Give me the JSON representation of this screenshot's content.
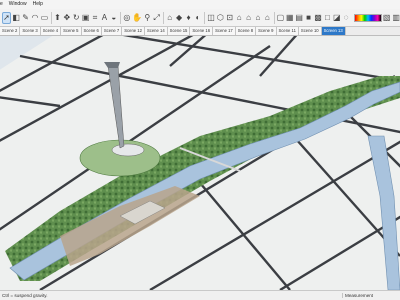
{
  "menubar": {
    "items": [
      {
        "label": "e"
      },
      {
        "label": "Window"
      },
      {
        "label": "Help"
      }
    ]
  },
  "toolbar": {
    "tools": [
      {
        "icon": "select-arrow-icon",
        "glyph": "➚",
        "selected": true
      },
      {
        "icon": "eraser-icon",
        "glyph": "◧"
      },
      {
        "icon": "line-pencil-icon",
        "glyph": "✎"
      },
      {
        "icon": "arc-icon",
        "glyph": "◠"
      },
      {
        "icon": "rectangle-icon",
        "glyph": "▭"
      },
      {
        "icon": "push-pull-icon",
        "glyph": "⬆"
      },
      {
        "icon": "move-icon",
        "glyph": "✥"
      },
      {
        "icon": "rotate-icon",
        "glyph": "↻"
      },
      {
        "icon": "offset-icon",
        "glyph": "▣"
      },
      {
        "icon": "tape-measure-icon",
        "glyph": "⌗"
      },
      {
        "icon": "text-icon",
        "glyph": "A"
      },
      {
        "icon": "paint-bucket-icon",
        "glyph": "◒"
      },
      {
        "icon": "orbit-icon",
        "glyph": "◎"
      },
      {
        "icon": "pan-icon",
        "glyph": "✋"
      },
      {
        "icon": "zoom-icon",
        "glyph": "⚲"
      },
      {
        "icon": "zoom-extents-icon",
        "glyph": "⤢"
      },
      {
        "icon": "warehouse-icon",
        "glyph": "⌂"
      },
      {
        "icon": "extension-icon",
        "glyph": "◆"
      },
      {
        "icon": "ruby-gem-icon",
        "glyph": "♦"
      },
      {
        "icon": "style-icon",
        "glyph": "◐"
      },
      {
        "icon": "section-plane-icon",
        "glyph": "◫"
      },
      {
        "icon": "iso-view-icon",
        "glyph": "⬡"
      },
      {
        "icon": "top-view-icon",
        "glyph": "⊡"
      },
      {
        "icon": "front-view-icon",
        "glyph": "⌂"
      },
      {
        "icon": "right-view-icon",
        "glyph": "⌂"
      },
      {
        "icon": "back-view-icon",
        "glyph": "⌂"
      },
      {
        "icon": "left-view-icon",
        "glyph": "⌂"
      },
      {
        "icon": "xray-icon",
        "glyph": "▢"
      },
      {
        "icon": "wireframe-icon",
        "glyph": "▦"
      },
      {
        "icon": "hidden-line-icon",
        "glyph": "▤"
      },
      {
        "icon": "shaded-icon",
        "glyph": "■"
      },
      {
        "icon": "textured-icon",
        "glyph": "▩"
      },
      {
        "icon": "monochrome-icon",
        "glyph": "□"
      },
      {
        "icon": "shadows-icon",
        "glyph": "◪"
      },
      {
        "icon": "fog-icon",
        "glyph": "◌"
      }
    ],
    "color_ramp_icon": "color-ramp-icon",
    "trailing_tools": [
      {
        "icon": "edge-style-icon",
        "glyph": "▧"
      },
      {
        "icon": "profiles-icon",
        "glyph": "▥"
      }
    ]
  },
  "scene_tabs": [
    {
      "label": "Scene 2"
    },
    {
      "label": "Scene 3"
    },
    {
      "label": "Scene 4"
    },
    {
      "label": "Scene 5"
    },
    {
      "label": "Scene 6"
    },
    {
      "label": "Scene 7"
    },
    {
      "label": "Scene 12"
    },
    {
      "label": "Scene 14"
    },
    {
      "label": "Scene 15"
    },
    {
      "label": "Scene 16"
    },
    {
      "label": "Scene 17"
    },
    {
      "label": "Scene 8"
    },
    {
      "label": "Scene 9"
    },
    {
      "label": "Scene 11"
    },
    {
      "label": "Scene 10"
    },
    {
      "label": "Screen 13",
      "active": true
    }
  ],
  "status": {
    "hint": "Ctrl = suspend gravity.",
    "measurements_label": "Measurement"
  },
  "colors": {
    "ground": "#eef0ef",
    "road": "#3c3f44",
    "water": "#a9c3dd",
    "grass": "#5f8f4e",
    "sky": "#dfe6ec",
    "active_tab": "#2d78c8"
  }
}
